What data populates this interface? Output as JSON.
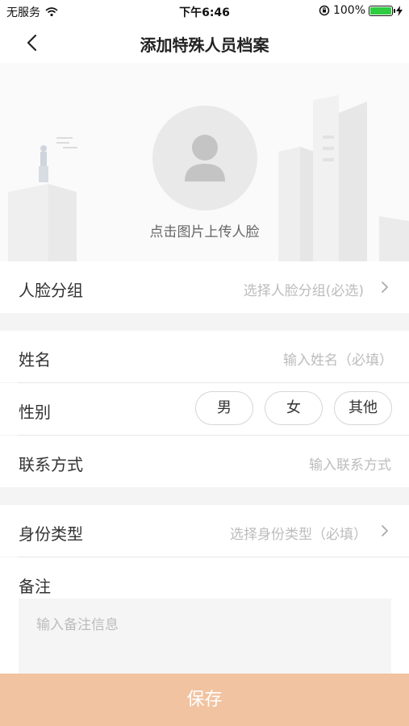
{
  "status_bar": {
    "carrier": "无服务",
    "time": "下午6:46",
    "battery": "100%"
  },
  "nav": {
    "title": "添加特殊人员档案"
  },
  "face": {
    "hint": "点击图片上传人脸"
  },
  "form": {
    "face_group": {
      "label": "人脸分组",
      "placeholder": "选择人脸分组(必选)"
    },
    "name": {
      "label": "姓名",
      "placeholder": "输入姓名（必填）"
    },
    "gender": {
      "label": "性别",
      "options": [
        "男",
        "女",
        "其他"
      ]
    },
    "contact": {
      "label": "联系方式",
      "placeholder": "输入联系方式"
    },
    "id_type": {
      "label": "身份类型",
      "placeholder": "选择身份类型（必填）"
    },
    "remark": {
      "label": "备注",
      "placeholder": "输入备注信息"
    }
  },
  "save_label": "保存",
  "colors": {
    "accent": "#f1c3a0",
    "placeholder": "#bcbcbc",
    "battery": "#2ecc40"
  }
}
